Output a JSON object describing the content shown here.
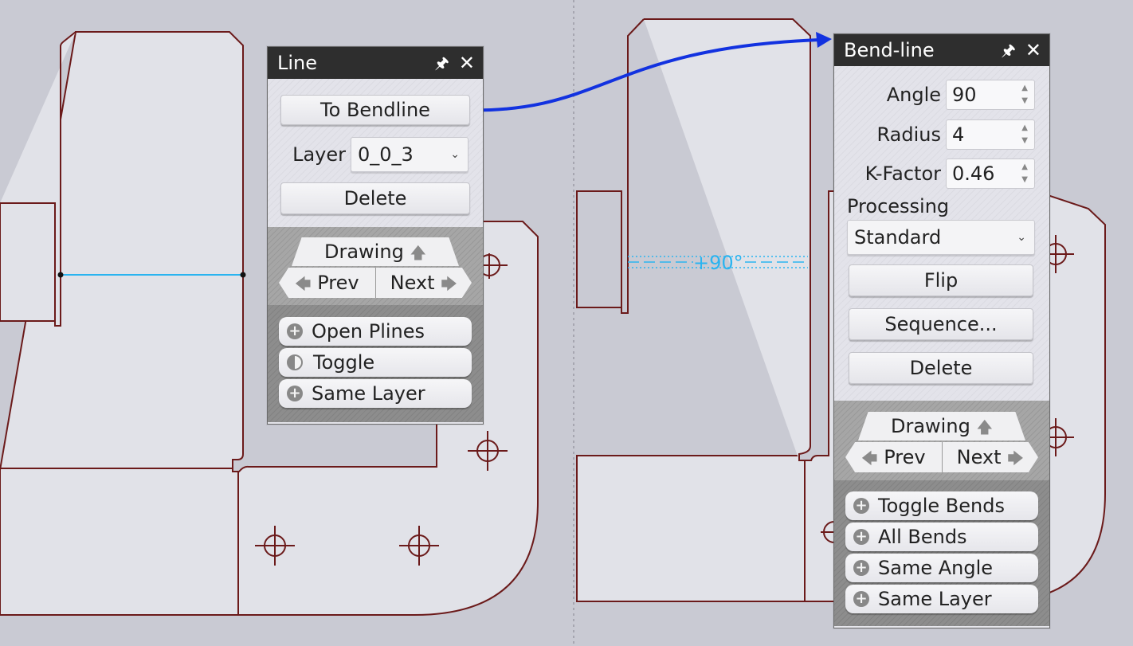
{
  "line_panel": {
    "title": "Line",
    "to_bendline_label": "To Bendline",
    "layer_label": "Layer",
    "layer_value": "0_0_3",
    "delete_label": "Delete",
    "drawing_label": "Drawing",
    "prev_label": "Prev",
    "next_label": "Next",
    "list": [
      "Open Plines",
      "Toggle",
      "Same Layer"
    ]
  },
  "bend_panel": {
    "title": "Bend-line",
    "angle_label": "Angle",
    "angle_value": "90",
    "radius_label": "Radius",
    "radius_value": "4",
    "kfactor_label": "K-Factor",
    "kfactor_value": "0.46",
    "processing_label": "Processing",
    "processing_value": "Standard",
    "flip_label": "Flip",
    "sequence_label": "Sequence...",
    "delete_label": "Delete",
    "drawing_label": "Drawing",
    "prev_label": "Prev",
    "next_label": "Next",
    "list": [
      "Toggle Bends",
      "All Bends",
      "Same Angle",
      "Same Layer"
    ]
  },
  "bend_annotation": "+90°",
  "icons": {
    "pin": "pin-icon",
    "close": "close-icon",
    "plus": "plus-circle-icon",
    "half": "half-circle-icon",
    "chevron": "chevron-down-icon"
  },
  "colors": {
    "outline": "#6b1a1a",
    "selected_line": "#2ab4f0",
    "arrow": "#1232e0",
    "titlebar": "#2e2e2e"
  }
}
